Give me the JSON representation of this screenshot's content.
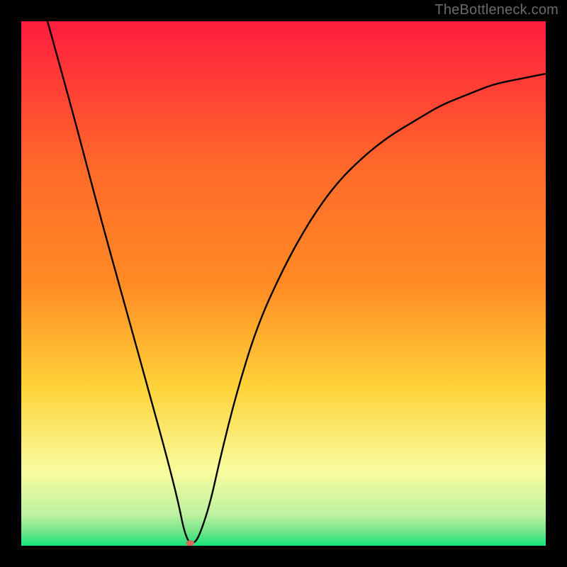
{
  "watermark": "TheBottleneck.com",
  "chart_data": {
    "type": "line",
    "title": "",
    "xlabel": "",
    "ylabel": "",
    "xlim": [
      0,
      100
    ],
    "ylim": [
      0,
      100
    ],
    "grid": false,
    "legend": false,
    "background_gradient": {
      "top": "#ff1c3e",
      "upper_mid": "#ff8a23",
      "mid": "#ffd43a",
      "lower_mid": "#f8fc9f",
      "near_bottom": "#7ce58b",
      "bottom": "#18e47c"
    },
    "series": [
      {
        "name": "bottleneck-curve",
        "color": "#000000",
        "x": [
          5,
          10,
          15,
          20,
          25,
          28,
          30,
          31,
          32,
          33,
          34,
          36,
          38,
          41,
          45,
          50,
          55,
          60,
          65,
          70,
          75,
          80,
          85,
          90,
          95,
          100
        ],
        "values": [
          100,
          82,
          63,
          45,
          27,
          16,
          8,
          3,
          0.5,
          0.5,
          2,
          8,
          17,
          29,
          42,
          53,
          62,
          69,
          74,
          78,
          81,
          84,
          86,
          88,
          89,
          90
        ]
      }
    ],
    "marker": {
      "name": "minimum-point",
      "x": 32.2,
      "y": 0.5,
      "color": "#d36a56",
      "rx": 6,
      "ry": 4
    }
  }
}
